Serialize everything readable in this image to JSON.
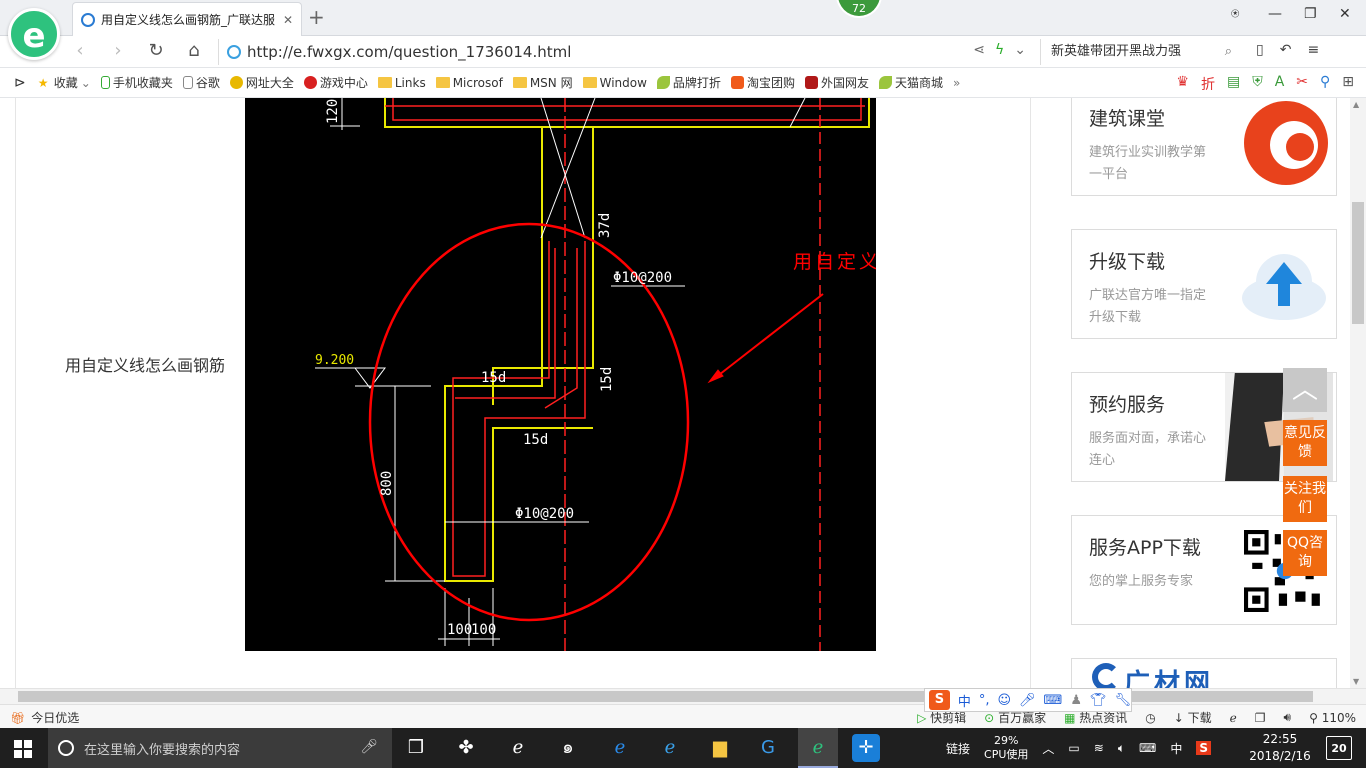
{
  "browser": {
    "tab_title": "用自定义线怎么画钢筋_广联达服",
    "badge_count": "72",
    "url": "http://e.fwxgx.com/question_1736014.html",
    "search_text": "新英雄带团开黑战力强"
  },
  "favorites": [
    {
      "label": "收藏",
      "icon": "star-icon"
    },
    {
      "label": "手机收藏夹",
      "icon": "phone-icon"
    },
    {
      "label": "谷歌",
      "icon": "page-icon"
    },
    {
      "label": "网址大全",
      "icon": "globe-icon"
    },
    {
      "label": "游戏中心",
      "icon": "game-icon"
    },
    {
      "label": "Links",
      "icon": "folder-icon"
    },
    {
      "label": "Microsof",
      "icon": "folder-icon"
    },
    {
      "label": "MSN 网",
      "icon": "folder-icon"
    },
    {
      "label": "Window",
      "icon": "folder-icon"
    },
    {
      "label": "品牌打折",
      "icon": "leaf-icon"
    },
    {
      "label": "淘宝团购",
      "icon": "taobao-icon"
    },
    {
      "label": "外国网友",
      "icon": "flag-icon"
    },
    {
      "label": "天猫商城",
      "icon": "leaf-icon"
    }
  ],
  "page": {
    "question_text": "用自定义线怎么画钢筋",
    "cad": {
      "annotation": "用自定义线定义",
      "dims": {
        "d120": "120",
        "d37d": "37d",
        "rebar_top": "Φ10@200",
        "elev": "9.200",
        "d15d_a": "15d",
        "d15d_b": "15d",
        "d15d_c": "15d",
        "d800": "800",
        "rebar_bottom": "Φ10@200",
        "d100_a": "100",
        "d100_b": "100"
      }
    },
    "sidebar_cards": [
      {
        "title": "建筑课堂",
        "desc": "建筑行业实训教学第一平台"
      },
      {
        "title": "升级下载",
        "desc": "广联达官方唯一指定升级下载"
      },
      {
        "title": "预约服务",
        "desc": "服务面对面，承诺心连心"
      },
      {
        "title": "服务APP下载",
        "desc": "您的掌上服务专家"
      }
    ],
    "partial_card_text": "广材网",
    "side_buttons": {
      "feedback": "意见反馈",
      "follow": "关注我们",
      "qq": "QQ咨询"
    }
  },
  "statusbar": {
    "left": "今日优选",
    "items": [
      "快剪辑",
      "百万赢家",
      "热点资讯",
      "下载"
    ],
    "zoom": "110%"
  },
  "ime": {
    "brand": "S",
    "mode": "中"
  },
  "taskbar": {
    "search_placeholder": "在这里输入你要搜索的内容",
    "links_label": "链接",
    "cpu_percent": "29%",
    "cpu_label": "CPU使用",
    "input_lang": "中",
    "time": "22:55",
    "date": "2018/2/16",
    "notification_count": "20"
  },
  "colors": {
    "cad_red": "#ff0000",
    "cad_yellow": "#e8e800",
    "accent_orange": "#f06a10",
    "browser_green": "#2ec27e"
  }
}
